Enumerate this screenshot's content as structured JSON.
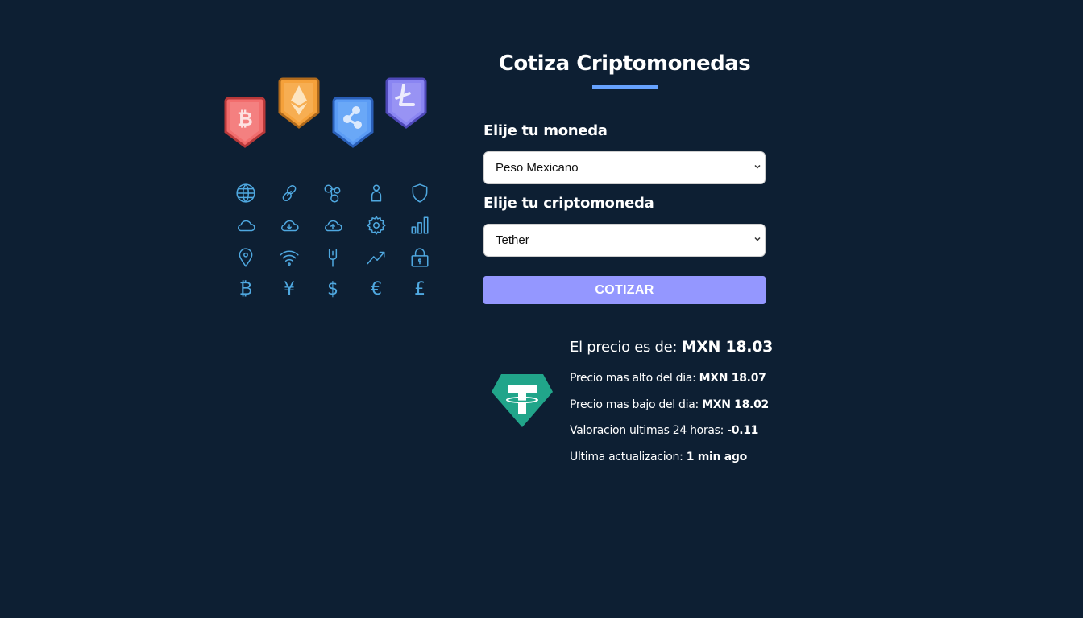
{
  "title": "Cotiza Criptomonedas",
  "form": {
    "currency_label": "Elije tu moneda",
    "currency_value": "Peso Mexicano",
    "crypto_label": "Elije tu criptomoneda",
    "crypto_value": "Tether",
    "submit_label": "Cotizar"
  },
  "result": {
    "price_label": "El precio es de: ",
    "price_value": "MXN 18.03",
    "high_label": "Precio mas alto del dia: ",
    "high_value": "MXN 18.07",
    "low_label": "Precio mas bajo del dia: ",
    "low_value": "MXN 18.02",
    "change_label": "Valoracion ultimas 24 horas: ",
    "change_value": "-0.11",
    "updated_label": "Ultima actualizacion: ",
    "updated_value": "1 min ago",
    "coin_logo": "tether-logo"
  },
  "art": {
    "badges": [
      "bitcoin-badge",
      "ethereum-badge",
      "ripple-badge",
      "litecoin-badge"
    ],
    "badge_colors": [
      "#f26d6d",
      "#f5a13a",
      "#5b9cf5",
      "#8a85f2"
    ],
    "currency_glyphs": [
      "₿",
      "¥",
      "$",
      "€",
      "£"
    ],
    "icon_color": "#4fa8e0"
  },
  "colors": {
    "background": "#0d1f33",
    "accent": "#66a2fe",
    "button": "#9497ff",
    "tether": "#21a58a"
  }
}
